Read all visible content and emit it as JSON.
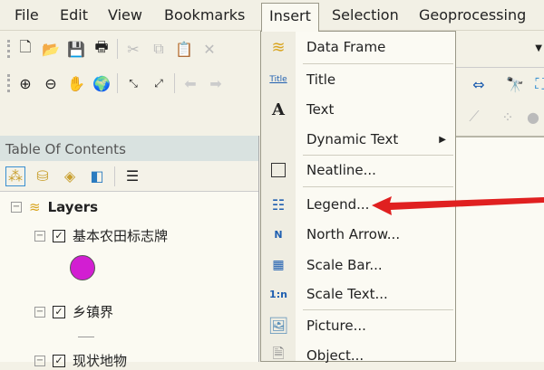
{
  "menubar": {
    "items": [
      "File",
      "Edit",
      "View",
      "Bookmarks",
      "Insert",
      "Selection",
      "Geoprocessing"
    ]
  },
  "toc": {
    "title": "Table Of Contents",
    "root": "Layers",
    "layers": [
      "基本农田标志牌",
      "乡镇界",
      "现状地物"
    ]
  },
  "insert_menu": {
    "items": [
      {
        "label": "Data Frame",
        "icon": "data-frame-icon"
      },
      {
        "label": "Title",
        "icon": "title-icon",
        "icon_text": "Title"
      },
      {
        "label": "Text",
        "icon": "text-icon",
        "icon_text": "A"
      },
      {
        "label": "Dynamic Text",
        "icon": "none",
        "submenu": "▶"
      },
      {
        "label": "Neatline...",
        "icon": "neatline-icon"
      },
      {
        "label": "Legend...",
        "icon": "legend-icon"
      },
      {
        "label": "North Arrow...",
        "icon": "north-arrow-icon",
        "icon_text": "N"
      },
      {
        "label": "Scale Bar...",
        "icon": "scale-bar-icon"
      },
      {
        "label": "Scale Text...",
        "icon": "scale-text-icon",
        "icon_text": "1:n"
      },
      {
        "label": "Picture...",
        "icon": "picture-icon"
      },
      {
        "label": "Object...",
        "icon": "object-icon"
      }
    ]
  },
  "colors": {
    "highlight_arrow": "#e02020",
    "symbol_fill": "#d21ed2"
  }
}
